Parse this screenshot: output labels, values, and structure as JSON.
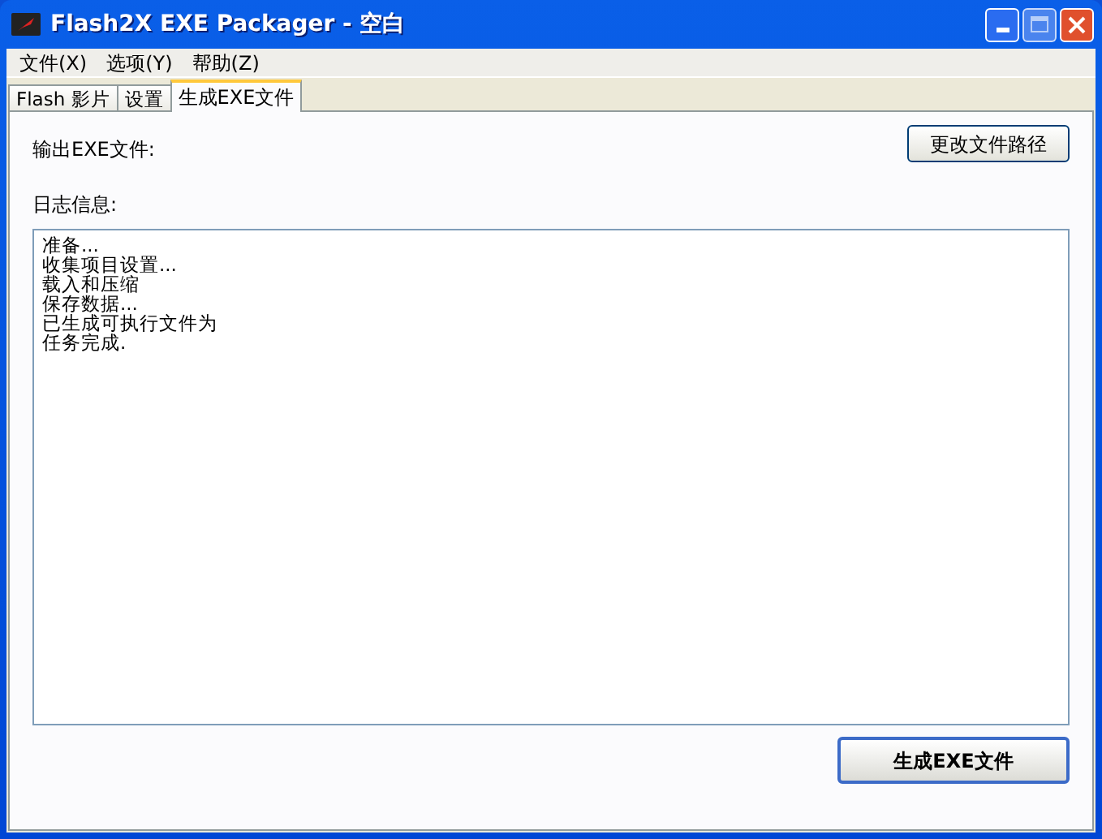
{
  "window": {
    "title": "Flash2X EXE Packager - 空白"
  },
  "menu": [
    "文件(X)",
    "选项(Y)",
    "帮助(Z)"
  ],
  "tabs": [
    {
      "label": "Flash 影片",
      "selected": false
    },
    {
      "label": "设置",
      "selected": false
    },
    {
      "label": "生成EXE文件",
      "selected": true
    }
  ],
  "output_label": "输出EXE文件:",
  "change_path_button": "更改文件路径",
  "log_label": "日志信息:",
  "log_lines": [
    "准备...",
    "收集项目设置...",
    "载入和压缩",
    "保存数据...",
    "已生成可执行文件为",
    "任务完成."
  ],
  "generate_button": "生成EXE文件"
}
